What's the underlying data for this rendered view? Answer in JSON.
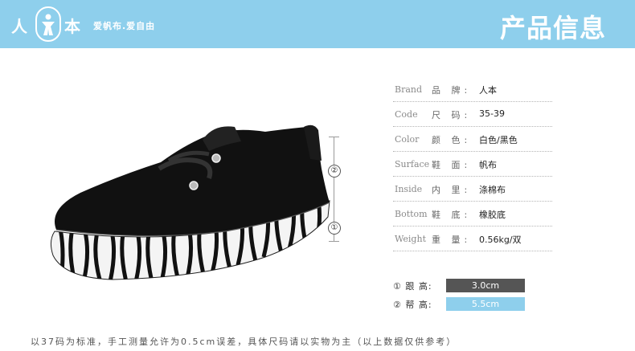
{
  "header": {
    "logo_left": "人",
    "logo_right": "本",
    "slogan": "爱帆布.爱自由",
    "title": "产品信息",
    "bg_color": "#8ecfec"
  },
  "measure": {
    "mark_1": "①",
    "mark_2": "②"
  },
  "specs": [
    {
      "en": "Brand",
      "cn": "品 牌:",
      "value": "人本"
    },
    {
      "en": "Code",
      "cn": "尺 码:",
      "value": "35-39"
    },
    {
      "en": "Color",
      "cn": "颜 色:",
      "value": "白色/黑色"
    },
    {
      "en": "Surface",
      "cn": "鞋 面:",
      "value": "帆布"
    },
    {
      "en": "Inside",
      "cn": "内 里:",
      "value": "涤棉布"
    },
    {
      "en": "Bottom",
      "cn": "鞋 底:",
      "value": "橡胶底"
    },
    {
      "en": "Weight",
      "cn": "重 量:",
      "value": "0.56kg/双"
    }
  ],
  "heights": [
    {
      "label": "① 跟 高:",
      "value": "3.0cm",
      "color": "#555555"
    },
    {
      "label": "② 帮 高:",
      "value": "5.5cm",
      "color": "#8ecfec"
    }
  ],
  "footnote": "以37码为标准，手工测量允许为0.5cm误差，具体尺码请以实物为主（以上数据仅供参考）"
}
